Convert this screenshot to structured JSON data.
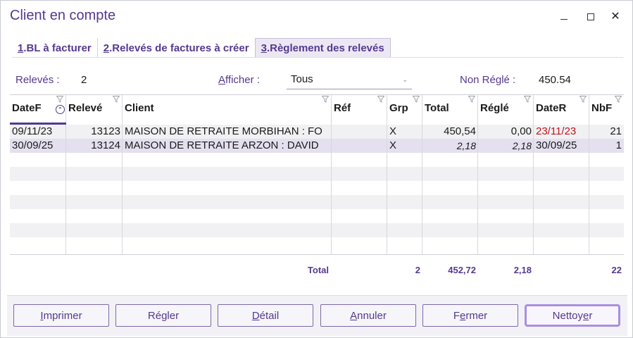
{
  "window": {
    "title": "Client en compte",
    "controls": {
      "minimize": "—",
      "maximize": "☐",
      "close": "✕"
    }
  },
  "tabs": [
    {
      "num": "1",
      "label": ".BL à facturer"
    },
    {
      "num": "2",
      "label": ".Relevés de factures à créer"
    },
    {
      "num": "3",
      "label": ".Règlement des relevés"
    }
  ],
  "info": {
    "releves_label": "Relevés :",
    "releves_value": "2",
    "afficher_label_first": "A",
    "afficher_label_rest": "fficher :",
    "afficher_value": "Tous",
    "non_regle_label": "Non Réglé :",
    "non_regle_value": "450.54"
  },
  "grid": {
    "columns": [
      "DateF",
      "Relevé",
      "Client",
      "Réf",
      "Grp",
      "Total",
      "Réglé",
      "DateR",
      "NbF"
    ],
    "rows": [
      {
        "datef": "09/11/23",
        "releve": "13123",
        "client": "MAISON DE RETRAITE MORBIHAN : FO",
        "ref": "",
        "grp": "X",
        "total": "450,54",
        "regle": "0,00",
        "dater": "23/11/23",
        "nbf": "21"
      },
      {
        "datef": "30/09/25",
        "releve": "13124",
        "client": "MAISON DE RETRAITE ARZON : DAVID",
        "ref": "",
        "grp": "X",
        "total": "2,18",
        "regle": "2,18",
        "dater": "30/09/25",
        "nbf": "1"
      }
    ],
    "totals": {
      "label": "Total",
      "grp": "2",
      "total": "452,72",
      "regle": "2,18",
      "nbf": "22"
    }
  },
  "buttons": [
    {
      "u": "I",
      "rest": "mprimer"
    },
    {
      "pre": "Ré",
      "u": "g",
      "rest": "ler"
    },
    {
      "u": "D",
      "rest": "étail"
    },
    {
      "u": "A",
      "rest": "nnuler"
    },
    {
      "pre": "F",
      "u": "e",
      "rest": "rmer"
    },
    {
      "pre": "Nettoy",
      "u": "e",
      "rest": "r"
    }
  ],
  "colors": {
    "accent": "#55398f",
    "overdue": "#c0141e",
    "selected_row": "#e4e0ef"
  }
}
